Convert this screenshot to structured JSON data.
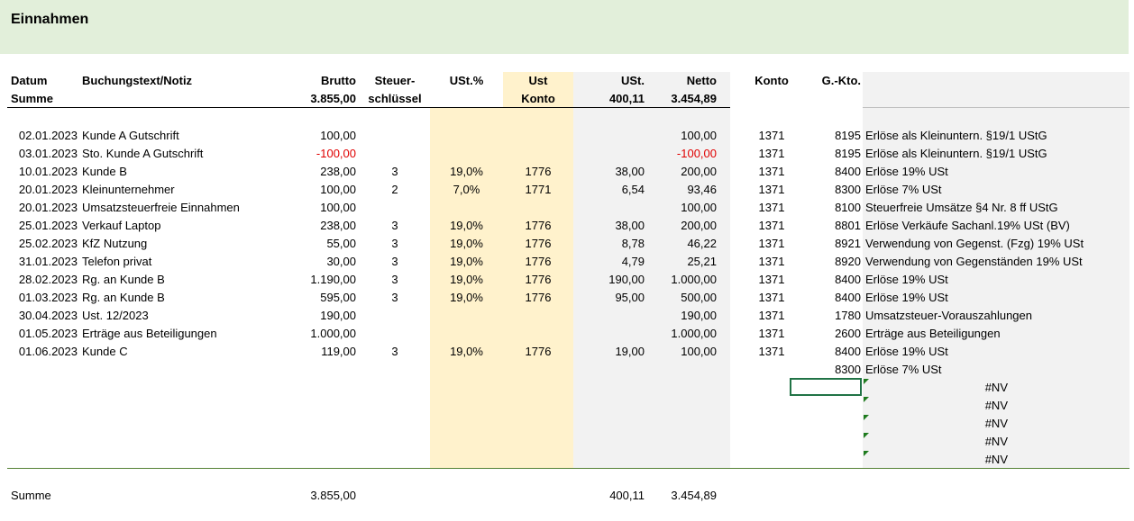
{
  "sheet": {
    "title": "Einnahmen",
    "headers": {
      "datum": "Datum",
      "buchungstext": "Buchungstext/Notiz",
      "brutto": "Brutto",
      "steuer_line1": "Steuer-",
      "steuer_line2": "schlüssel",
      "ust_pct": "USt.%",
      "ust_konto_line1": "Ust",
      "ust_konto_line2": "Konto",
      "ust": "USt.",
      "netto": "Netto",
      "konto": "Konto",
      "gkto": "G.-Kto."
    },
    "summe_row": {
      "label": "Summe",
      "brutto": "3.855,00",
      "ust": "400,11",
      "netto": "3.454,89"
    },
    "rows": [
      {
        "datum": "02.01.2023",
        "text": "Kunde A Gutschrift",
        "brutto": "100,00",
        "neg": false,
        "schl": "",
        "pct": "",
        "ukto": "",
        "ust": "",
        "netto": "100,00",
        "konto": "1371",
        "gkto": "8195",
        "desc": "Erlöse als Kleinuntern. §19/1 UStG"
      },
      {
        "datum": "03.01.2023",
        "text": "Sto. Kunde A Gutschrift",
        "brutto": "-100,00",
        "neg": true,
        "schl": "",
        "pct": "",
        "ukto": "",
        "ust": "",
        "netto": "-100,00",
        "konto": "1371",
        "gkto": "8195",
        "desc": "Erlöse als Kleinuntern. §19/1 UStG"
      },
      {
        "datum": "10.01.2023",
        "text": "Kunde B",
        "brutto": "238,00",
        "neg": false,
        "schl": "3",
        "pct": "19,0%",
        "ukto": "1776",
        "ust": "38,00",
        "netto": "200,00",
        "konto": "1371",
        "gkto": "8400",
        "desc": "Erlöse 19% USt"
      },
      {
        "datum": "20.01.2023",
        "text": "Kleinunternehmer",
        "brutto": "100,00",
        "neg": false,
        "schl": "2",
        "pct": "7,0%",
        "ukto": "1771",
        "ust": "6,54",
        "netto": "93,46",
        "konto": "1371",
        "gkto": "8300",
        "desc": "Erlöse 7% USt"
      },
      {
        "datum": "20.01.2023",
        "text": "Umsatzsteuerfreie Einnahmen",
        "brutto": "100,00",
        "neg": false,
        "schl": "",
        "pct": "",
        "ukto": "",
        "ust": "",
        "netto": "100,00",
        "konto": "1371",
        "gkto": "8100",
        "desc": "Steuerfreie Umsätze §4 Nr. 8 ff UStG"
      },
      {
        "datum": "25.01.2023",
        "text": "Verkauf Laptop",
        "brutto": "238,00",
        "neg": false,
        "schl": "3",
        "pct": "19,0%",
        "ukto": "1776",
        "ust": "38,00",
        "netto": "200,00",
        "konto": "1371",
        "gkto": "8801",
        "desc": "Erlöse Verkäufe Sachanl.19% USt (BV)"
      },
      {
        "datum": "25.02.2023",
        "text": "KfZ Nutzung",
        "brutto": "55,00",
        "neg": false,
        "schl": "3",
        "pct": "19,0%",
        "ukto": "1776",
        "ust": "8,78",
        "netto": "46,22",
        "konto": "1371",
        "gkto": "8921",
        "desc": "Verwendung von Gegenst. (Fzg) 19% USt"
      },
      {
        "datum": "31.01.2023",
        "text": "Telefon privat",
        "brutto": "30,00",
        "neg": false,
        "schl": "3",
        "pct": "19,0%",
        "ukto": "1776",
        "ust": "4,79",
        "netto": "25,21",
        "konto": "1371",
        "gkto": "8920",
        "desc": "Verwendung von Gegenständen 19% USt"
      },
      {
        "datum": "28.02.2023",
        "text": "Rg. an Kunde B",
        "brutto": "1.190,00",
        "neg": false,
        "schl": "3",
        "pct": "19,0%",
        "ukto": "1776",
        "ust": "190,00",
        "netto": "1.000,00",
        "konto": "1371",
        "gkto": "8400",
        "desc": "Erlöse 19% USt"
      },
      {
        "datum": "01.03.2023",
        "text": "Rg. an Kunde B",
        "brutto": "595,00",
        "neg": false,
        "schl": "3",
        "pct": "19,0%",
        "ukto": "1776",
        "ust": "95,00",
        "netto": "500,00",
        "konto": "1371",
        "gkto": "8400",
        "desc": "Erlöse 19% USt"
      },
      {
        "datum": "30.04.2023",
        "text": "Ust. 12/2023",
        "brutto": "190,00",
        "neg": false,
        "schl": "",
        "pct": "",
        "ukto": "",
        "ust": "",
        "netto": "190,00",
        "konto": "1371",
        "gkto": "1780",
        "desc": "Umsatzsteuer-Vorauszahlungen"
      },
      {
        "datum": "01.05.2023",
        "text": "Erträge aus Beteiligungen",
        "brutto": "1.000,00",
        "neg": false,
        "schl": "",
        "pct": "",
        "ukto": "",
        "ust": "",
        "netto": "1.000,00",
        "konto": "1371",
        "gkto": "2600",
        "desc": "Erträge aus Beteiligungen"
      },
      {
        "datum": "01.06.2023",
        "text": "Kunde C",
        "brutto": "119,00",
        "neg": false,
        "schl": "3",
        "pct": "19,0%",
        "ukto": "1776",
        "ust": "19,00",
        "netto": "100,00",
        "konto": "1371",
        "gkto": "8400",
        "desc": "Erlöse 19% USt"
      },
      {
        "datum": "",
        "text": "",
        "brutto": "",
        "neg": false,
        "schl": "",
        "pct": "",
        "ukto": "",
        "ust": "",
        "netto": "",
        "konto": "",
        "gkto": "8300",
        "desc": "Erlöse 7% USt"
      }
    ],
    "nv_rows": [
      "#NV",
      "#NV",
      "#NV",
      "#NV",
      "#NV"
    ],
    "footer": {
      "label": "Summe",
      "brutto": "3.855,00",
      "ust": "400,11",
      "netto": "3.454,89"
    },
    "colors": {
      "banner": "#e2efda",
      "yellow": "#fff2cc",
      "gray": "#f2f2f2",
      "negative": "#e00000",
      "selection": "#217346"
    }
  }
}
